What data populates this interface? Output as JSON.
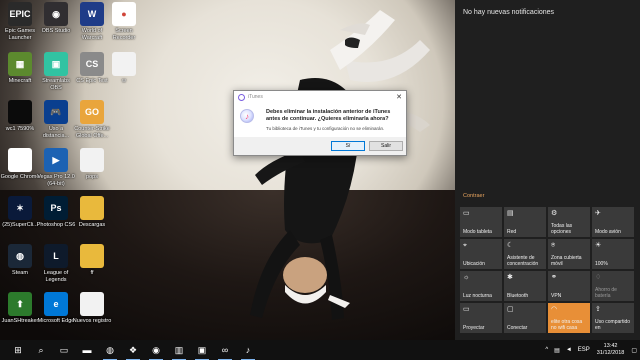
{
  "desktop": {
    "icons": [
      {
        "label": "Epic Games Launcher",
        "name": "epic-games-launcher-icon",
        "glyph": "EPIC",
        "color": "#2a2a2a"
      },
      {
        "label": "OBS Studio",
        "name": "obs-studio-icon",
        "glyph": "◉",
        "color": "#302e31"
      },
      {
        "label": "World of Warcraft",
        "name": "world-of-warcraft-icon",
        "glyph": "W",
        "color": "#1f3c88"
      },
      {
        "label": "Screen Recorder",
        "name": "screen-recorder-icon",
        "glyph": "●",
        "color": "#ffffff"
      },
      {
        "label": "Minecraft",
        "name": "minecraft-icon",
        "glyph": "▦",
        "color": "#5c8a2e"
      },
      {
        "label": "Streamlabs OBS",
        "name": "streamlabs-obs-icon",
        "glyph": "▣",
        "color": "#31c3a2"
      },
      {
        "label": "CS Epic Test",
        "name": "cs-epic-test-icon",
        "glyph": "CS",
        "color": "#8a8a8a"
      },
      {
        "label": "w",
        "name": "text-file-icon",
        "glyph": "",
        "color": "#f2f2f2"
      },
      {
        "label": "wc1 7590%",
        "name": "wc-folder-icon",
        "glyph": "",
        "color": "#0b0b0b"
      },
      {
        "label": "Uso a distancia...",
        "name": "remote-play-icon",
        "glyph": "🎮",
        "color": "#0a3f8f"
      },
      {
        "label": "Counter-Strike Global Offe...",
        "name": "counter-strike-icon",
        "glyph": "GO",
        "color": "#e9a53c"
      },
      {
        "label": "Google Chrome",
        "name": "google-chrome-icon",
        "glyph": "",
        "color": "#ffffff"
      },
      {
        "label": "Vegas Pro 12.0 (64-bit)",
        "name": "vegas-pro-icon",
        "glyph": "▶",
        "color": "#1c62b3"
      },
      {
        "label": "pops",
        "name": "pops-file-icon",
        "glyph": "",
        "color": "#f2f2f2"
      },
      {
        "label": "(25)SuperCli...",
        "name": "supercell-icon",
        "glyph": "✶",
        "color": "#0a1a3a"
      },
      {
        "label": "Photoshop CS6",
        "name": "photoshop-icon",
        "glyph": "Ps",
        "color": "#001d34"
      },
      {
        "label": "Descargas",
        "name": "downloads-folder-icon",
        "glyph": "",
        "color": "#e9b93c"
      },
      {
        "label": "Steam",
        "name": "steam-icon",
        "glyph": "◍",
        "color": "#1b2838"
      },
      {
        "label": "League of Legends",
        "name": "league-of-legends-icon",
        "glyph": "L",
        "color": "#0e1a2b"
      },
      {
        "label": "ff",
        "name": "ff-folder-icon",
        "glyph": "",
        "color": "#e9b93c"
      },
      {
        "label": "JuanSHtreaker",
        "name": "juan-shortcut-icon",
        "glyph": "⬆",
        "color": "#2c7a2c"
      },
      {
        "label": "Microsoft Edge",
        "name": "microsoft-edge-icon",
        "glyph": "e",
        "color": "#0078d7"
      },
      {
        "label": "Nuevos registro",
        "name": "new-registry-icon",
        "glyph": "",
        "color": "#f2f2f2"
      }
    ]
  },
  "dialog": {
    "title": "iTunes",
    "message": "Debes eliminar la instalación anterior de iTunes antes de continuar. ¿Quieres eliminarla ahora?",
    "detail": "Tu biblioteca de iTunes y tu configuración no se eliminarán.",
    "yes_label": "Sí",
    "exit_label": "Salir"
  },
  "action_center": {
    "header": "No hay nuevas notificaciones",
    "collapse_label": "Contraer",
    "tiles": [
      {
        "label": "Modo tableta",
        "icon": "tablet-mode-icon",
        "glyph": "▭",
        "state": "normal"
      },
      {
        "label": "Red",
        "icon": "network-icon",
        "glyph": "▤",
        "state": "normal"
      },
      {
        "label": "Todas las opciones",
        "icon": "settings-icon",
        "glyph": "⚙",
        "state": "normal"
      },
      {
        "label": "Modo avión",
        "icon": "airplane-icon",
        "glyph": "✈",
        "state": "normal"
      },
      {
        "label": "Ubicación",
        "icon": "location-icon",
        "glyph": "⌖",
        "state": "normal"
      },
      {
        "label": "Asistente de concentración",
        "icon": "focus-assist-icon",
        "glyph": "☾",
        "state": "normal"
      },
      {
        "label": "Zona cubierta móvil",
        "icon": "mobile-hotspot-icon",
        "glyph": "⍟",
        "state": "normal"
      },
      {
        "label": "100%",
        "icon": "brightness-icon",
        "glyph": "☀",
        "state": "normal"
      },
      {
        "label": "Luz nocturna",
        "icon": "night-light-icon",
        "glyph": "☼",
        "state": "normal"
      },
      {
        "label": "Bluetooth",
        "icon": "bluetooth-icon",
        "glyph": "✱",
        "state": "normal"
      },
      {
        "label": "VPN",
        "icon": "vpn-icon",
        "glyph": "⚭",
        "state": "normal"
      },
      {
        "label": "Ahorro de batería",
        "icon": "battery-saver-icon",
        "glyph": "♢",
        "state": "off"
      },
      {
        "label": "Proyectar",
        "icon": "project-icon",
        "glyph": "▭",
        "state": "normal"
      },
      {
        "label": "Conectar",
        "icon": "connect-icon",
        "glyph": "▢",
        "state": "normal"
      },
      {
        "label": "elite otra cosa no wifi casa",
        "icon": "wifi-icon",
        "glyph": "◠",
        "state": "on"
      },
      {
        "label": "Uso compartido en",
        "icon": "nearby-share-icon",
        "glyph": "⇪",
        "state": "normal"
      }
    ]
  },
  "taskbar": {
    "items": [
      {
        "name": "start-button-icon",
        "glyph": "⊞"
      },
      {
        "name": "search-icon",
        "glyph": "⌕"
      },
      {
        "name": "task-view-icon",
        "glyph": "▭"
      },
      {
        "name": "file-explorer-icon",
        "glyph": "▬"
      },
      {
        "name": "chrome-taskbar-icon",
        "glyph": "◍"
      },
      {
        "name": "dropbox-taskbar-icon",
        "glyph": "❖"
      },
      {
        "name": "obs-taskbar-icon",
        "glyph": "◉"
      },
      {
        "name": "store-taskbar-icon",
        "glyph": "▥"
      },
      {
        "name": "streamlabs-taskbar-icon",
        "glyph": "▣"
      },
      {
        "name": "link-taskbar-icon",
        "glyph": "∞"
      },
      {
        "name": "itunes-taskbar-icon",
        "glyph": "♪"
      }
    ],
    "tray": {
      "language": "ESP",
      "time": "13:42",
      "date": "31/12/2018"
    }
  }
}
